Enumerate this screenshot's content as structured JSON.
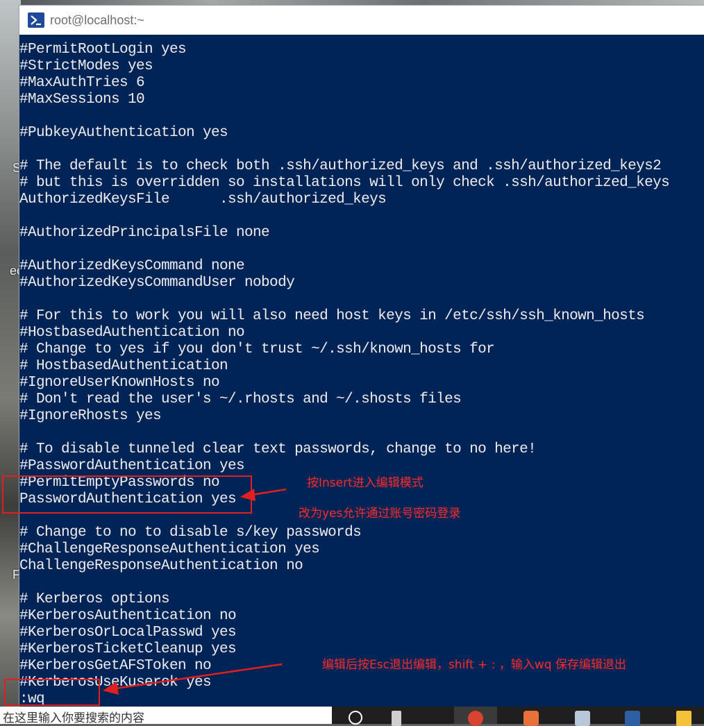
{
  "window": {
    "title": "root@localhost:~"
  },
  "desktop": {
    "fragments": [
      "S",
      "ec",
      "F"
    ]
  },
  "console": {
    "lines": [
      "#PermitRootLogin yes",
      "#StrictModes yes",
      "#MaxAuthTries 6",
      "#MaxSessions 10",
      "",
      "#PubkeyAuthentication yes",
      "",
      "# The default is to check both .ssh/authorized_keys and .ssh/authorized_keys2",
      "# but this is overridden so installations will only check .ssh/authorized_keys",
      "AuthorizedKeysFile      .ssh/authorized_keys",
      "",
      "#AuthorizedPrincipalsFile none",
      "",
      "#AuthorizedKeysCommand none",
      "#AuthorizedKeysCommandUser nobody",
      "",
      "# For this to work you will also need host keys in /etc/ssh/ssh_known_hosts",
      "#HostbasedAuthentication no",
      "# Change to yes if you don't trust ~/.ssh/known_hosts for",
      "# HostbasedAuthentication",
      "#IgnoreUserKnownHosts no",
      "# Don't read the user's ~/.rhosts and ~/.shosts files",
      "#IgnoreRhosts yes",
      "",
      "# To disable tunneled clear text passwords, change to no here!",
      "#PasswordAuthentication yes",
      "#PermitEmptyPasswords no",
      "PasswordAuthentication yes",
      "",
      "# Change to no to disable s/key passwords",
      "#ChallengeResponseAuthentication yes",
      "ChallengeResponseAuthentication no",
      "",
      "# Kerberos options",
      "#KerberosAuthentication no",
      "#KerberosOrLocalPasswd yes",
      "#KerberosTicketCleanup yes",
      "#KerberosGetAFSToken no",
      "#KerberosUseKuserok yes",
      ":wq"
    ]
  },
  "annotations": {
    "insert_note": "按Insert进入编辑模式",
    "yes_note": "改为yes允许通过账号密码登录",
    "save_note": "编辑后按Esc退出编辑，shift + : ，输入wq 保存编辑退出",
    "color": "#e02020"
  },
  "taskbar": {
    "search_text": "在这里输入你要搜索的内容"
  },
  "colors": {
    "console_bg": "#012456",
    "console_fg": "#eeedf0",
    "annotation": "#ff2b2b"
  }
}
